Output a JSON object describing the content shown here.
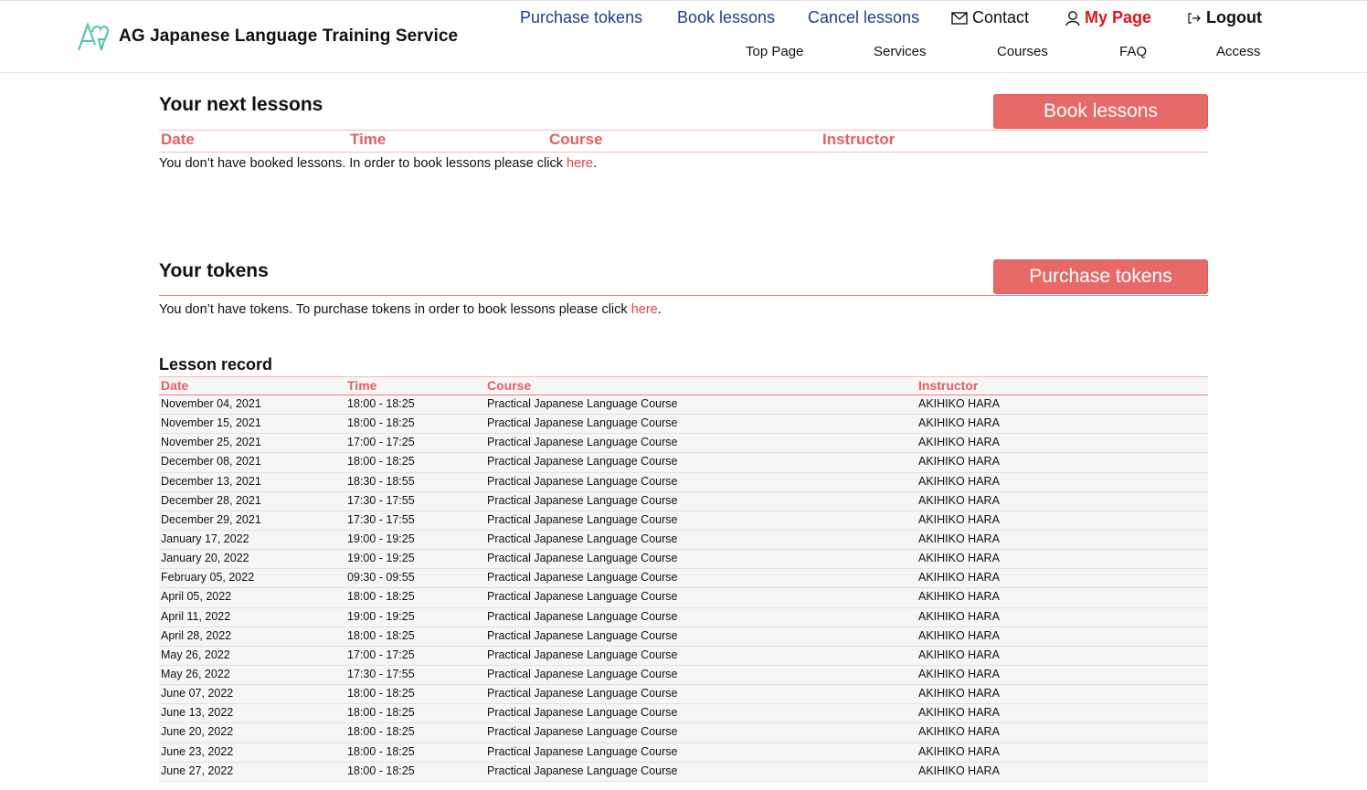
{
  "header": {
    "brand": "AG Japanese Language Training Service",
    "logo_icon": "ag-heart-logo",
    "brand_color": "#4fc3a9",
    "nav_top": [
      {
        "label": "Purchase tokens",
        "icon": null
      },
      {
        "label": "Book lessons",
        "icon": null
      },
      {
        "label": "Cancel lessons",
        "icon": null
      },
      {
        "label": "Contact",
        "icon": "envelope-icon"
      },
      {
        "label": "My Page",
        "icon": "user-icon"
      },
      {
        "label": "Logout",
        "icon": "logout-icon"
      }
    ],
    "nav_bottom": [
      {
        "label": "Top Page"
      },
      {
        "label": "Services"
      },
      {
        "label": "Courses"
      },
      {
        "label": "FAQ"
      },
      {
        "label": "Access"
      }
    ]
  },
  "next_lessons": {
    "title": "Your next lessons",
    "button_label": "Book lessons",
    "columns": [
      "Date",
      "Time",
      "Course",
      "Instructor"
    ],
    "empty_message": "You don’t have booked lessons. In order to book lessons please click ",
    "link_label": "here",
    "suffix": "."
  },
  "tokens": {
    "title": "Your tokens",
    "button_label": "Purchase tokens",
    "empty_message": "You don’t have tokens. To purchase tokens in order to book lessons please click ",
    "link_label": "here",
    "suffix": "."
  },
  "lesson_record": {
    "title": "Lesson record",
    "columns": [
      "Date",
      "Time",
      "Course",
      "Instructor"
    ],
    "rows": [
      [
        "November 04, 2021",
        "18:00 - 18:25",
        "Practical Japanese Language Course",
        "AKIHIKO HARA"
      ],
      [
        "November 15, 2021",
        "18:00 - 18:25",
        "Practical Japanese Language Course",
        "AKIHIKO HARA"
      ],
      [
        "November 25, 2021",
        "17:00 - 17:25",
        "Practical Japanese Language Course",
        "AKIHIKO HARA"
      ],
      [
        "December 08, 2021",
        "18:00 - 18:25",
        "Practical Japanese Language Course",
        "AKIHIKO HARA"
      ],
      [
        "December 13, 2021",
        "18:30 - 18:55",
        "Practical Japanese Language Course",
        "AKIHIKO HARA"
      ],
      [
        "December 28, 2021",
        "17:30 - 17:55",
        "Practical Japanese Language Course",
        "AKIHIKO HARA"
      ],
      [
        "December 29, 2021",
        "17:30 - 17:55",
        "Practical Japanese Language Course",
        "AKIHIKO HARA"
      ],
      [
        "January 17, 2022",
        "19:00 - 19:25",
        "Practical Japanese Language Course",
        "AKIHIKO HARA"
      ],
      [
        "January 20, 2022",
        "19:00 - 19:25",
        "Practical Japanese Language Course",
        "AKIHIKO HARA"
      ],
      [
        "February 05, 2022",
        "09:30 - 09:55",
        "Practical Japanese Language Course",
        "AKIHIKO HARA"
      ],
      [
        "April 05, 2022",
        "18:00 - 18:25",
        "Practical Japanese Language Course",
        "AKIHIKO HARA"
      ],
      [
        "April 11, 2022",
        "19:00 - 19:25",
        "Practical Japanese Language Course",
        "AKIHIKO HARA"
      ],
      [
        "April 28, 2022",
        "18:00 - 18:25",
        "Practical Japanese Language Course",
        "AKIHIKO HARA"
      ],
      [
        "May 26, 2022",
        "17:00 - 17:25",
        "Practical Japanese Language Course",
        "AKIHIKO HARA"
      ],
      [
        "May 26, 2022",
        "17:30 - 17:55",
        "Practical Japanese Language Course",
        "AKIHIKO HARA"
      ],
      [
        "June 07, 2022",
        "18:00 - 18:25",
        "Practical Japanese Language Course",
        "AKIHIKO HARA"
      ],
      [
        "June 13, 2022",
        "18:00 - 18:25",
        "Practical Japanese Language Course",
        "AKIHIKO HARA"
      ],
      [
        "June 20, 2022",
        "18:00 - 18:25",
        "Practical Japanese Language Course",
        "AKIHIKO HARA"
      ],
      [
        "June 23, 2022",
        "18:00 - 18:25",
        "Practical Japanese Language Course",
        "AKIHIKO HARA"
      ],
      [
        "June 27, 2022",
        "18:00 - 18:25",
        "Practical Japanese Language Course",
        "AKIHIKO HARA"
      ]
    ]
  }
}
